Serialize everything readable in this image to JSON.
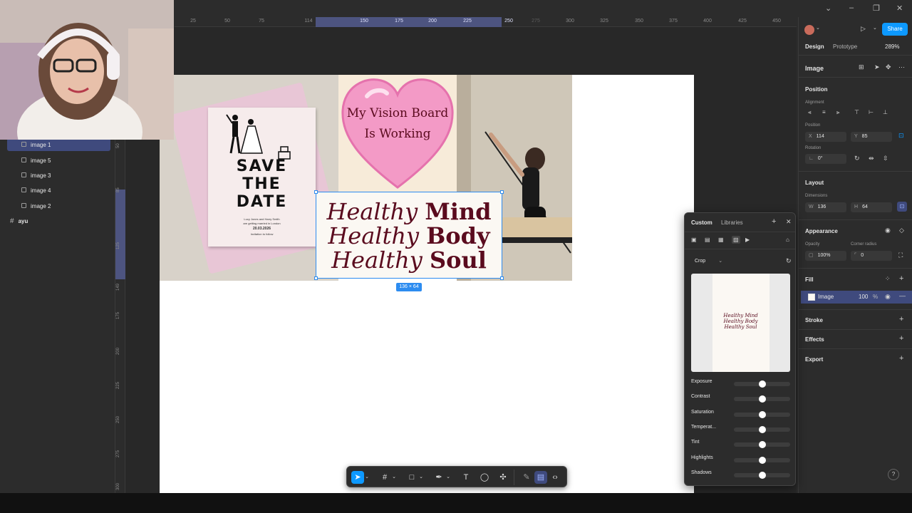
{
  "ruler_top": {
    "ticks": [
      "25",
      "50",
      "75",
      "114",
      "150",
      "175",
      "200",
      "225",
      "250",
      "275",
      "300",
      "325",
      "350",
      "375",
      "400",
      "425",
      "450"
    ]
  },
  "ruler_left": {
    "ticks": [
      "50",
      "85",
      "125",
      "149",
      "175",
      "200",
      "225",
      "250",
      "275",
      "300"
    ]
  },
  "layers": [
    {
      "label": "image 1"
    },
    {
      "label": "image 5"
    },
    {
      "label": "image 3"
    },
    {
      "label": "image 4"
    },
    {
      "label": "image 2"
    }
  ],
  "frame_layer": {
    "label": "ayu"
  },
  "canvas": {
    "heart_text_line1": "My Vision Board",
    "heart_text_line2": "Is Working",
    "card": {
      "line1": "SAVE",
      "line2": "THE",
      "line3": "DATE",
      "names": "Lucy Jones and Harry Smith",
      "sub": "are getting married in London",
      "date": "20.03.2026",
      "invite": "Invitation to follow"
    },
    "healthy": {
      "line1_a": "Healthy",
      "line1_b": "Mind",
      "line2_a": "Healthy",
      "line2_b": "Body",
      "line3_a": "Healthy",
      "line3_b": "Soul"
    },
    "size_badge": "136 × 64"
  },
  "right_panel": {
    "share_label": "Share",
    "tab_design": "Design",
    "tab_prototype": "Prototype",
    "zoom": "289%",
    "layer_type": "Image",
    "position_title": "Position",
    "alignment_label": "Alignment",
    "position_label": "Position",
    "x_key": "X",
    "x_value": "114",
    "y_key": "Y",
    "y_value": "85",
    "rotation_label": "Rotation",
    "rotation_value": "0°",
    "layout_title": "Layout",
    "dimensions_label": "Dimensions",
    "w_key": "W",
    "w_value": "136",
    "h_key": "H",
    "h_value": "64",
    "appearance_title": "Appearance",
    "opacity_label": "Opacity",
    "opacity_value": "100%",
    "corner_label": "Corner radius",
    "corner_value": "0",
    "fill_title": "Fill",
    "fill_type": "Image",
    "fill_opacity": "100",
    "fill_unit": "%",
    "stroke_title": "Stroke",
    "effects_title": "Effects",
    "export_title": "Export"
  },
  "image_panel": {
    "tab_custom": "Custom",
    "tab_libraries": "Libraries",
    "mode": "Crop",
    "preview": {
      "l1": "Healthy Mind",
      "l2": "Healthy Body",
      "l3": "Healthy Soul"
    },
    "sliders": [
      {
        "label": "Exposure",
        "value": 0.5
      },
      {
        "label": "Contrast",
        "value": 0.5
      },
      {
        "label": "Saturation",
        "value": 0.5
      },
      {
        "label": "Temperat...",
        "value": 0.5
      },
      {
        "label": "Tint",
        "value": 0.5
      },
      {
        "label": "Highlights",
        "value": 0.5
      },
      {
        "label": "Shadows",
        "value": 0.5
      }
    ]
  },
  "toolbar": {
    "tools": [
      "move-tool",
      "frame-tool",
      "shape-tool",
      "pen-tool",
      "text-tool",
      "comment-tool",
      "actions-tool",
      "draw-mode",
      "design-mode",
      "dev-mode"
    ]
  },
  "help_label": "?"
}
